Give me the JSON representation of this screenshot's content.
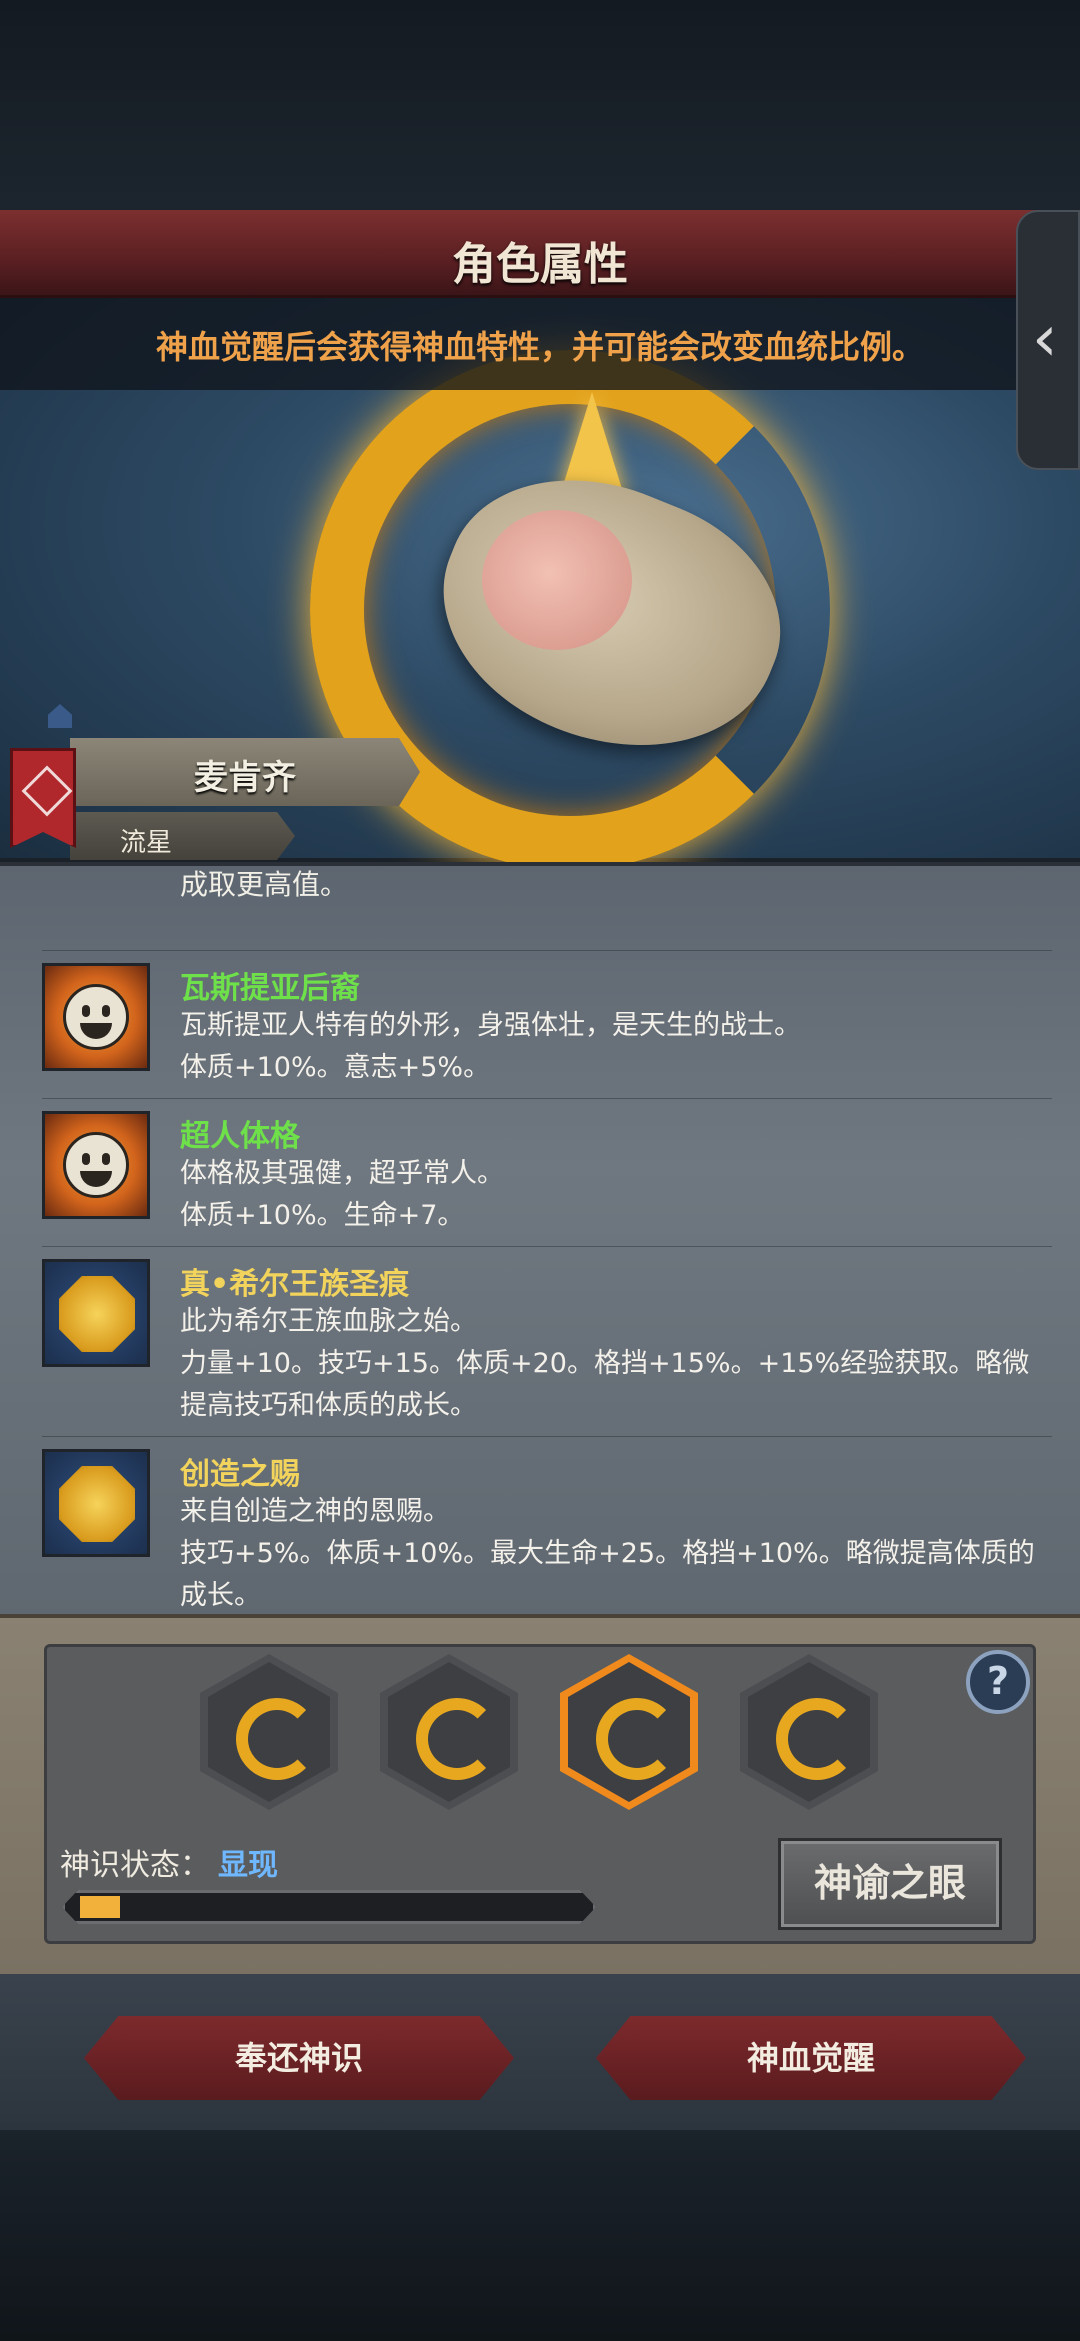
{
  "header": {
    "title": "角色属性"
  },
  "hero": {
    "hint": "神血觉醒后会获得神血特性，并可能会改变血统比例。"
  },
  "character": {
    "name": "麦肯齐",
    "title": "流星"
  },
  "edge_tab": {
    "glyph": "‹"
  },
  "traits": {
    "partial_text": "成取更高值。",
    "items": [
      {
        "name": "瓦斯提亚后裔",
        "color": "#6ee04a",
        "desc_line1": "瓦斯提亚人特有的外形，身强体壮，是天生的战士。",
        "desc_line2": "体质+10%。意志+5%。",
        "icon": "smile-icon"
      },
      {
        "name": "超人体格",
        "color": "#6ee04a",
        "desc_line1": "体格极其强健，超乎常人。",
        "desc_line2": "体质+10%。生命+7。",
        "icon": "smile-icon"
      },
      {
        "name": "真•希尔王族圣痕",
        "color": "#f2d35c",
        "desc_line1": "此为希尔王族血脉之始。",
        "desc_line2": "力量+10。技巧+15。体质+20。格挡+15%。+15%经验获取。略微提高技巧和体质的成长。",
        "icon": "coin-icon"
      },
      {
        "name": "创造之赐",
        "color": "#f2d35c",
        "desc_line1": "来自创造之神的恩赐。",
        "desc_line2": "技巧+5%。体质+10%。最大生命+25。格挡+10%。略微提高体质的成长。",
        "icon": "coin-icon"
      }
    ]
  },
  "divine": {
    "status_label": "神识状态：",
    "status_value": "显现",
    "progress": 0.08,
    "oracle_button": "神谕之眼",
    "help": "?"
  },
  "actions": {
    "return_label": "奉还神识",
    "awaken_label": "神血觉醒"
  }
}
